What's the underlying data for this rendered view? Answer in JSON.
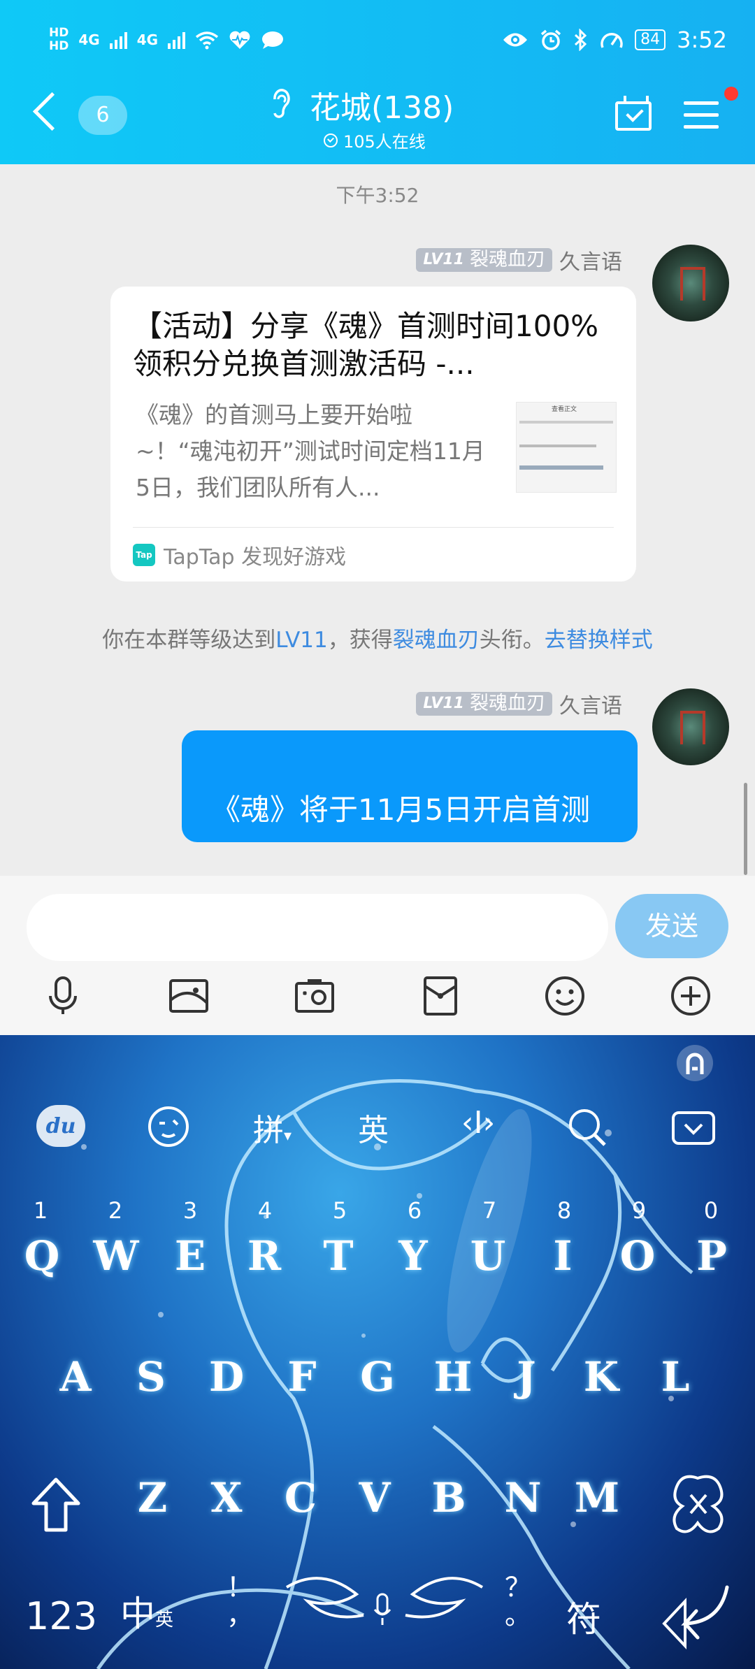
{
  "status_bar": {
    "signal_labels": [
      "HD",
      "HD",
      "4G",
      "4G"
    ],
    "battery": "84",
    "time": "3:52"
  },
  "header": {
    "unread_count": "6",
    "group_title": "花城(138)",
    "online_text": "105人在线"
  },
  "chat": {
    "timestamp": "下午3:52",
    "messages": [
      {
        "sender_level": "LV11",
        "sender_badge": "裂魂血刃",
        "sender_name": "久言语",
        "card": {
          "title": "【活动】分享《魂》首测时间100%领积分兑换首测激活码 -...",
          "description": "《魂》的首测马上要开始啦~！“魂沌初开”测试时间定档11月5日，我们团队所有人...",
          "thumb_title": "查看正文",
          "source": "TapTap 发现好游戏"
        }
      },
      {
        "sender_level": "LV11",
        "sender_badge": "裂魂血刃",
        "sender_name": "久言语",
        "text": "《魂》将于11月5日开启首测"
      }
    ],
    "system_notice": {
      "prefix": "你在本群等级达到",
      "level": "LV11",
      "middle": "，获得",
      "title": "裂魂血刃",
      "suffix": "头衔。",
      "action": "去替换样式"
    }
  },
  "input": {
    "placeholder": "",
    "send_label": "发送"
  },
  "keyboard": {
    "toolbar": {
      "pinyin": "拼",
      "english": "英",
      "cursor": "‹I›",
      "du": "du"
    },
    "numbers": [
      "1",
      "2",
      "3",
      "4",
      "5",
      "6",
      "7",
      "8",
      "9",
      "0"
    ],
    "row1": [
      "Q",
      "W",
      "E",
      "R",
      "T",
      "Y",
      "U",
      "I",
      "O",
      "P"
    ],
    "row2": [
      "A",
      "S",
      "D",
      "F",
      "G",
      "H",
      "J",
      "K",
      "L"
    ],
    "row3": [
      "Z",
      "X",
      "C",
      "V",
      "B",
      "N",
      "M"
    ],
    "bottom": {
      "num_key": "123",
      "lang_key": "中",
      "lang_sub": "英",
      "punct": "，",
      "punct_top": "！",
      "punct2": "。",
      "punct2_top": "？",
      "symbol_key": "符"
    }
  }
}
